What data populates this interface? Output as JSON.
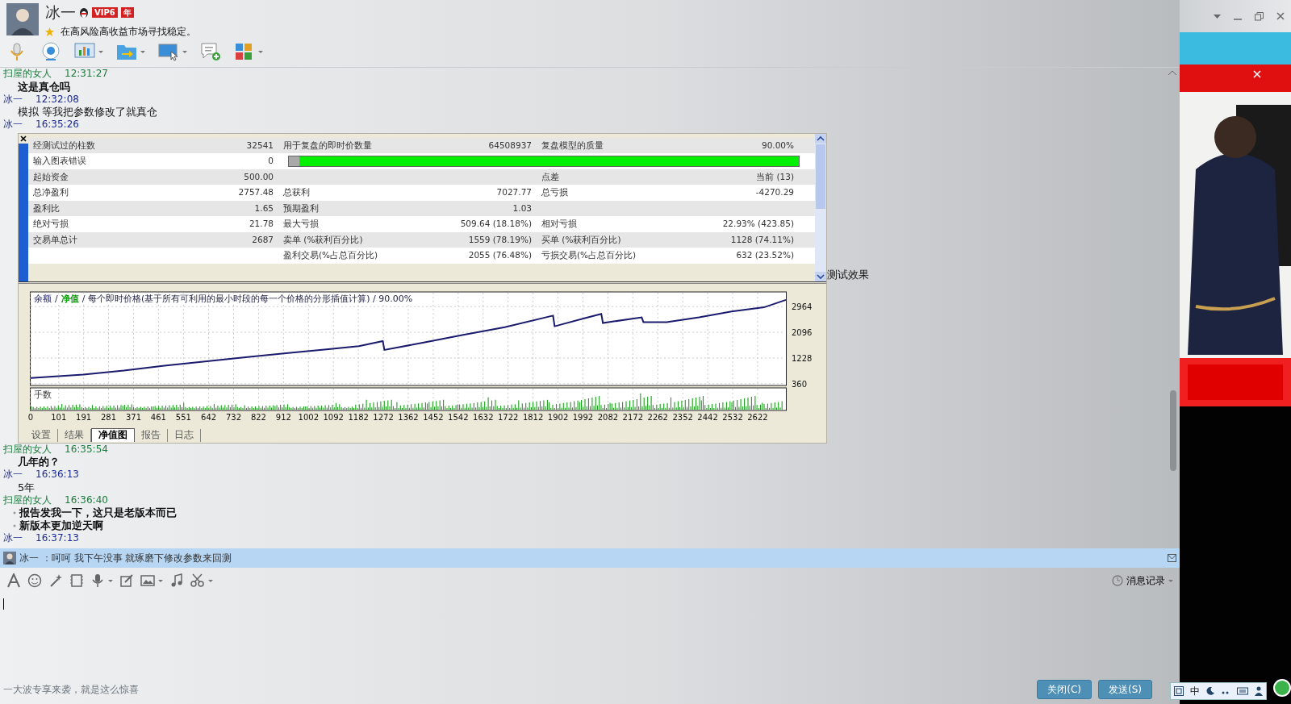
{
  "profile": {
    "name": "冰一",
    "badge": "VIP6",
    "badge_suffix": "年",
    "signature": "在高风险高收益市场寻找稳定。"
  },
  "messages": [
    {
      "sender": "扫屋的女人",
      "kind": "peer",
      "time": "12:31:27",
      "lines": [
        "这是真仓吗"
      ]
    },
    {
      "sender": "冰一",
      "kind": "self",
      "time": "12:32:08",
      "lines": [
        "模拟  等我把参数修改了就真仓"
      ]
    },
    {
      "sender": "冰一",
      "kind": "self",
      "time": "16:35:26",
      "caption": "测试效果",
      "tester": {
        "rows": [
          {
            "kind": "text",
            "column_1": "经测试过的柱数",
            "column_2": "32541",
            "column_3": "用于复盘的即时价数量",
            "column_4": "64508937",
            "column_5": "复盘模型的质量",
            "column_6": "90.00%"
          },
          {
            "kind": "bar",
            "column_1": "输入图表错误",
            "column_2": "0",
            "level": 0.98
          },
          {
            "kind": "text",
            "column_1": "起始资金",
            "column_2": "500.00",
            "column_5": "点差",
            "column_6": "当前 (13)"
          },
          {
            "kind": "text",
            "column_1": "总净盈利",
            "column_2": "2757.48",
            "column_3": "总获利",
            "column_4": "7027.77",
            "column_5": "总亏损",
            "column_6": "-4270.29"
          },
          {
            "kind": "text",
            "column_1": "盈利比",
            "column_2": "1.65",
            "column_3": "预期盈利",
            "column_4": "1.03"
          },
          {
            "kind": "text",
            "column_1": "绝对亏损",
            "column_2": "21.78",
            "column_3": "最大亏损",
            "column_4": "509.64 (18.18%)",
            "column_5": "相对亏损",
            "column_6": "22.93% (423.85)"
          },
          {
            "kind": "text",
            "column_1": "交易单总计",
            "column_2": "2687",
            "column_3": "卖单 (%获利百分比)",
            "column_4": "1559 (78.19%)",
            "column_5": "买单 (%获利百分比)",
            "column_6": "1128 (74.11%)"
          },
          {
            "kind": "text",
            "column_3": "盈利交易(%占总百分比)",
            "column_4": "2055 (76.48%)",
            "column_5": "亏损交易(%占总百分比)",
            "column_6": "632 (23.52%)"
          }
        ],
        "legend": [
          {
            "text": "/"
          },
          {
            "text": "净值",
            "color": "#00a000"
          },
          {
            "text": "/ 每个即时价格(基于所有可利用的最小时段的每一个价格的分形插值计算) / 90.00%"
          }
        ],
        "chart_data": {
          "type": "line",
          "grid": true,
          "xlim": [
            0,
            2724
          ],
          "ylim": [
            300,
            3460
          ],
          "xticks": [
            0,
            101,
            191,
            281,
            371,
            461,
            551,
            642,
            732,
            822,
            912,
            1002,
            1092,
            1182,
            1272,
            1362,
            1452,
            1542,
            1632,
            1722,
            1812,
            1902,
            1992,
            2082,
            2172,
            2262,
            2352,
            2442,
            2532,
            2622
          ],
          "yticks": [
            360,
            1228,
            2096,
            2964
          ],
          "x": [
            0,
            190,
            336,
            482,
            629,
            775,
            921,
            1067,
            1184,
            1270,
            1276,
            1418,
            1564,
            1710,
            1884,
            1890,
            2002,
            2058,
            2064,
            2204,
            2210,
            2294,
            2411,
            2528,
            2645,
            2724
          ],
          "series": [
            {
              "name": "余额",
              "color": "#1a1a6e",
              "values": [
                550,
                670,
                800,
                970,
                1110,
                1250,
                1390,
                1520,
                1630,
                1800,
                1500,
                1750,
                2020,
                2270,
                2660,
                2300,
                2580,
                2720,
                2410,
                2600,
                2440,
                2440,
                2600,
                2800,
                2940,
                3190
              ]
            }
          ]
        },
        "volume_label": "手数",
        "tabs": [
          {
            "label": "设置",
            "selected": false
          },
          {
            "label": "结果",
            "selected": false
          },
          {
            "label": "净值图",
            "selected": true
          },
          {
            "label": "报告",
            "selected": false
          },
          {
            "label": "日志",
            "selected": false
          }
        ]
      }
    },
    {
      "sender": "扫屋的女人",
      "kind": "peer",
      "time": "16:35:54",
      "lines": [
        "几年的？"
      ]
    },
    {
      "sender": "冰一",
      "kind": "self",
      "time": "16:36:13",
      "lines": [
        "5年"
      ]
    },
    {
      "sender": "扫屋的女人",
      "kind": "peer",
      "time": "16:36:40",
      "bulleted": true,
      "lines": [
        "报告发我一下，这只是老版本而已",
        "新版本更加逆天啊"
      ]
    },
    {
      "sender": "冰一",
      "kind": "self",
      "time": "16:37:13"
    }
  ],
  "notice": {
    "text": "冰一 ：呵呵  我下午没事 就琢磨下修改参数来回测"
  },
  "history_label": "消息记录",
  "promo": "一大波专享来袭，就是这么惊喜",
  "buttons": [
    {
      "label": "关闭(C)"
    },
    {
      "label": "发送(S)"
    }
  ],
  "tray": {
    "ime": "中"
  }
}
